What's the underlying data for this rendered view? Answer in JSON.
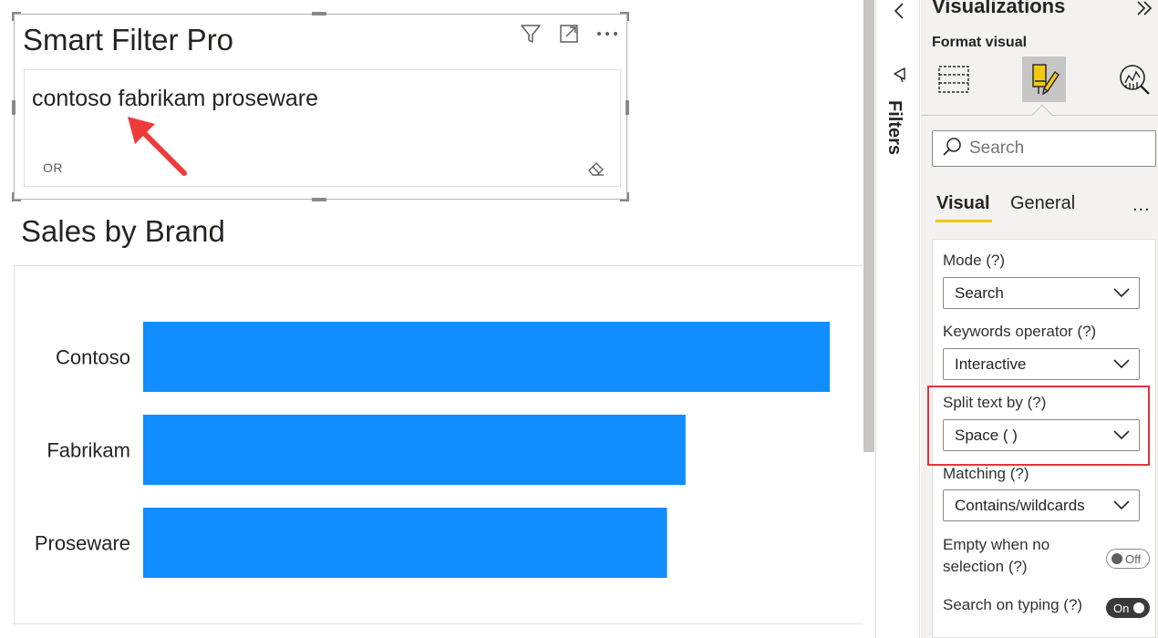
{
  "canvas": {
    "smart_filter": {
      "title": "Smart Filter Pro",
      "search_text": "contoso fabrikam proseware",
      "operator_badge": "OR",
      "header_icons": [
        "filter-icon",
        "focus-mode-icon",
        "more-options-icon"
      ]
    },
    "sales_chart": {
      "title": "Sales by Brand"
    }
  },
  "chart_data": {
    "type": "bar",
    "orientation": "horizontal",
    "title": "Sales by Brand",
    "categories": [
      "Contoso",
      "Fabrikam",
      "Proseware"
    ],
    "values": [
      100,
      79,
      76.3
    ],
    "xlabel": "",
    "ylabel": "",
    "xlim": [
      0,
      100
    ],
    "grid": false,
    "bar_color": "#118dff"
  },
  "filters_pane": {
    "label": "Filters"
  },
  "viz_pane": {
    "title": "Visualizations",
    "format_label": "Format visual",
    "tabs": [
      "build-visual-icon",
      "format-visual-icon",
      "analytics-icon"
    ],
    "active_tab": "format-visual-icon",
    "search": {
      "placeholder": "Search"
    },
    "subtabs": {
      "visual": "Visual",
      "general": "General",
      "more": "..."
    },
    "settings": {
      "mode_label": "Mode (?)",
      "mode_value": "Search",
      "keywords_label": "Keywords operator (?)",
      "keywords_value": "Interactive",
      "split_label": "Split text by (?)",
      "split_value": "Space ( )",
      "matching_label": "Matching (?)",
      "matching_value": "Contains/wildcards",
      "empty_label_1": "Empty when no",
      "empty_label_2": "selection (?)",
      "empty_toggle": "Off",
      "search_typing_label": "Search on typing (?)",
      "search_typing_toggle": "On"
    }
  },
  "colors": {
    "accent": "#f2c811",
    "bar": "#118dff",
    "highlight": "#e8313a",
    "annotation_arrow": "#f03a3a"
  }
}
